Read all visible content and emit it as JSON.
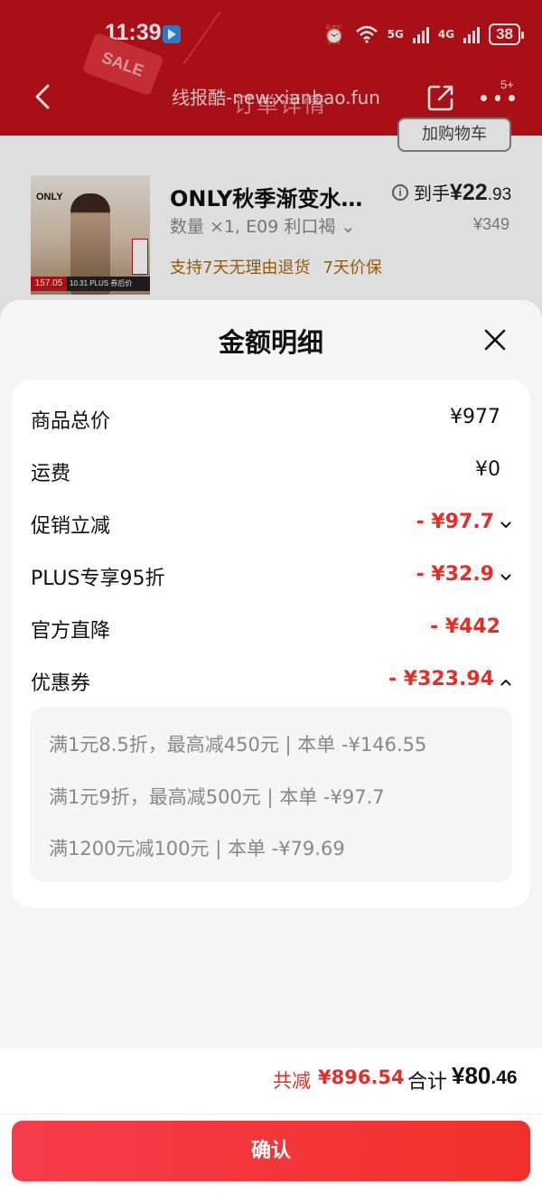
{
  "status_bar": {
    "time": "11:39",
    "network_5g": "5G",
    "network_4g": "4G",
    "battery": "38"
  },
  "nav": {
    "watermark": "线报酷-new.xianbao.fun",
    "title_ghost": "订单详情",
    "more_badge": "5+",
    "sale_tag": "SALE",
    "top_button": "加购物车"
  },
  "product": {
    "brand_logo": "ONLY",
    "title": "ONLY秋季渐变水…",
    "final_price_label": "到手",
    "final_price_int": "¥22",
    "final_price_dec": ".93",
    "spec": "数量 ×1, E09 利口褐",
    "original_price": "¥349",
    "services": [
      "支持7天无理由退货",
      "7天价保"
    ],
    "image_price_tag": "157.05",
    "image_promo_tag": "10.31 PLUS 券后价"
  },
  "sheet": {
    "title": "金额明细",
    "rows": [
      {
        "label": "商品总价",
        "value": "¥977"
      },
      {
        "label": "运费",
        "value": "¥0"
      },
      {
        "label": "促销立减",
        "value": "- ¥97.7"
      },
      {
        "label": "PLUS专享95折",
        "value": "- ¥32.9"
      },
      {
        "label": "官方直降",
        "value": "- ¥442"
      },
      {
        "label": "优惠券",
        "value": "- ¥323.94"
      }
    ],
    "coupons": [
      "满1元8.5折，最高减450元 | 本单 -¥146.55",
      "满1元9折，最高减500元 | 本单 -¥97.7",
      "满1200元减100元 | 本单 -¥79.69"
    ]
  },
  "footer": {
    "saved_label": "共减",
    "saved_value": "¥896.54",
    "total_label": "合计",
    "total_int": "¥80",
    "total_dec": ".46",
    "confirm_label": "确认"
  },
  "colors": {
    "header_red": "#c1121b",
    "discount_red": "#e52e27",
    "confirm_gradient_start": "#f63c4a",
    "confirm_gradient_end": "#f2312c",
    "service_brown": "#a86a10"
  },
  "icons": [
    "back-icon",
    "share-icon",
    "more-icon",
    "info-icon",
    "close-icon",
    "chevron-down-icon",
    "chevron-up-icon",
    "alarm-icon",
    "wifi-icon"
  ]
}
